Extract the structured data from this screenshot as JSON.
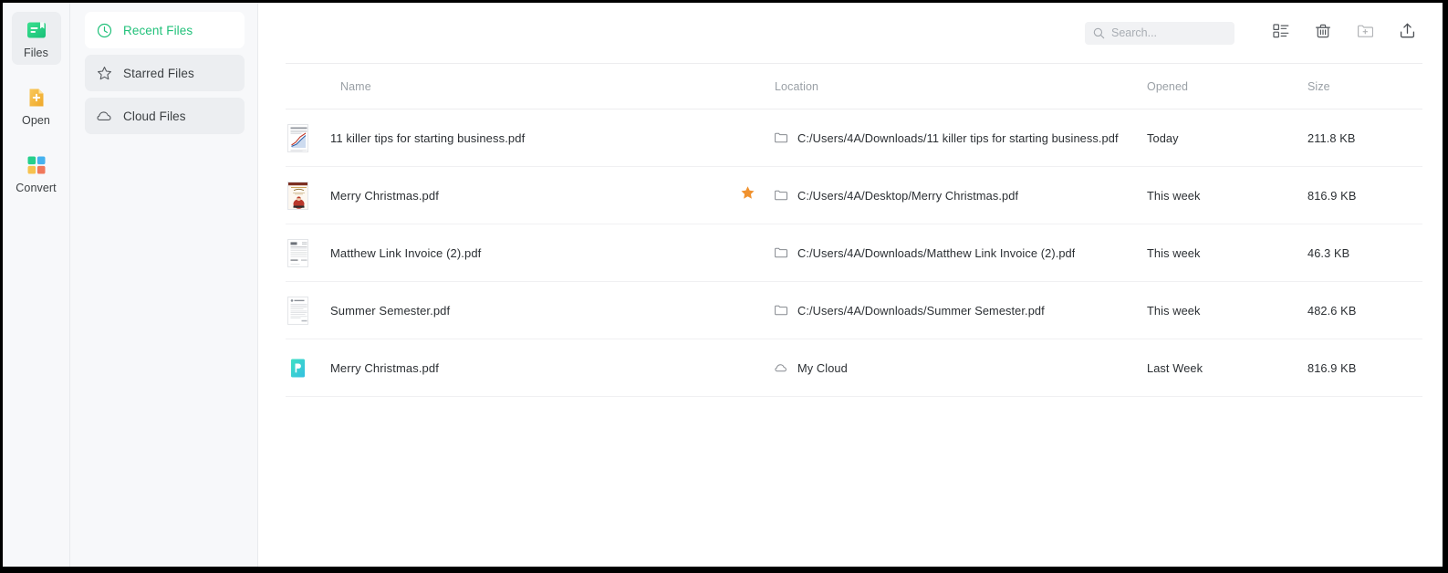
{
  "app": {
    "rail": [
      {
        "label": "Files",
        "icon": "files-icon",
        "active": true
      },
      {
        "label": "Open",
        "icon": "open-icon",
        "active": false
      },
      {
        "label": "Convert",
        "icon": "convert-icon",
        "active": false
      }
    ],
    "nav": [
      {
        "label": "Recent Files",
        "icon": "clock-icon",
        "active": true
      },
      {
        "label": "Starred Files",
        "icon": "star-icon",
        "active": false
      },
      {
        "label": "Cloud Files",
        "icon": "cloud-icon",
        "active": false
      }
    ]
  },
  "toolbar": {
    "search": {
      "value": "",
      "placeholder": "Search..."
    },
    "buttons": [
      {
        "name": "view-list-icon",
        "title": "List view",
        "dim": false
      },
      {
        "name": "trash-icon",
        "title": "Delete",
        "dim": false
      },
      {
        "name": "new-folder-icon",
        "title": "New folder",
        "dim": true
      },
      {
        "name": "upload-icon",
        "title": "Upload",
        "dim": false
      }
    ]
  },
  "table": {
    "columns": {
      "name": "Name",
      "location": "Location",
      "opened": "Opened",
      "size": "Size"
    },
    "rows": [
      {
        "name": "11 killer tips for starting business.pdf",
        "starred": false,
        "location": "C:/Users/4A/Downloads/11 killer tips for starting business.pdf",
        "location_icon": "folder-icon",
        "opened": "Today",
        "size": "211.8 KB",
        "thumb": "chart-doc"
      },
      {
        "name": "Merry Christmas.pdf",
        "starred": true,
        "location": "C:/Users/4A/Desktop/Merry Christmas.pdf",
        "location_icon": "folder-icon",
        "opened": "This week",
        "size": "816.9 KB",
        "thumb": "christmas-doc"
      },
      {
        "name": "Matthew Link Invoice (2).pdf",
        "starred": false,
        "location": "C:/Users/4A/Downloads/Matthew Link Invoice (2).pdf",
        "location_icon": "folder-icon",
        "opened": "This week",
        "size": "46.3 KB",
        "thumb": "invoice-doc"
      },
      {
        "name": "Summer Semester.pdf",
        "starred": false,
        "location": "C:/Users/4A/Downloads/Summer Semester.pdf",
        "location_icon": "folder-icon",
        "opened": "This week",
        "size": "482.6 KB",
        "thumb": "text-doc"
      },
      {
        "name": "Merry Christmas.pdf",
        "starred": false,
        "location": "My Cloud",
        "location_icon": "cloud-icon",
        "opened": "Last Week",
        "size": "816.9 KB",
        "thumb": "cloud-file"
      }
    ]
  },
  "colors": {
    "accent_green": "#21c17a",
    "star_orange": "#f0922f",
    "open_yellow": "#f5b93c",
    "cloud_teal": "#3fd6c9",
    "rail_bg": "#f7f8fa",
    "text_primary": "#2b2f33",
    "text_muted": "#9aa0a6"
  }
}
